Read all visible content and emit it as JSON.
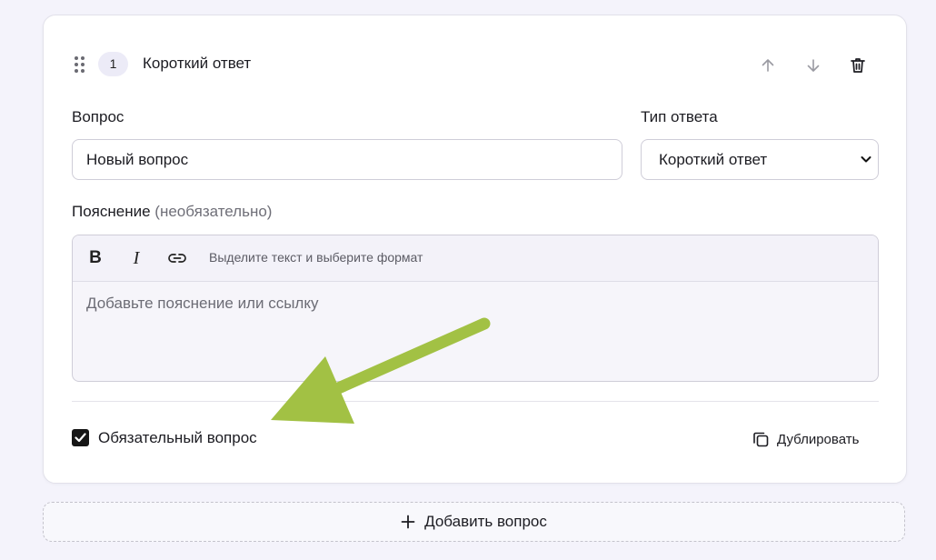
{
  "question": {
    "number": "1",
    "type_title": "Короткий ответ",
    "question_label": "Вопрос",
    "question_value": "Новый вопрос",
    "answer_type_label": "Тип ответа",
    "answer_type_value": "Короткий ответ",
    "explanation_label": "Пояснение",
    "explanation_optional": "(необязательно)",
    "toolbar": {
      "bold": "B",
      "italic": "I",
      "hint": "Выделите текст и выберите формат"
    },
    "explanation_placeholder": "Добавьте пояснение или ссылку",
    "required_label": "Обязательный вопрос",
    "required_checked": true,
    "duplicate_label": "Дублировать"
  },
  "add_question_label": "Добавить вопрос",
  "icons": {
    "drag": "drag-handle-icon",
    "up": "arrow-up-icon",
    "down": "arrow-down-icon",
    "delete": "trash-icon",
    "link": "link-icon",
    "duplicate": "copy-icon",
    "add": "plus-icon",
    "annotation": "green-arrow-annotation"
  },
  "colors": {
    "annotation_arrow": "#a2c144",
    "checkbox": "#161616",
    "background": "#f4f3fb"
  }
}
